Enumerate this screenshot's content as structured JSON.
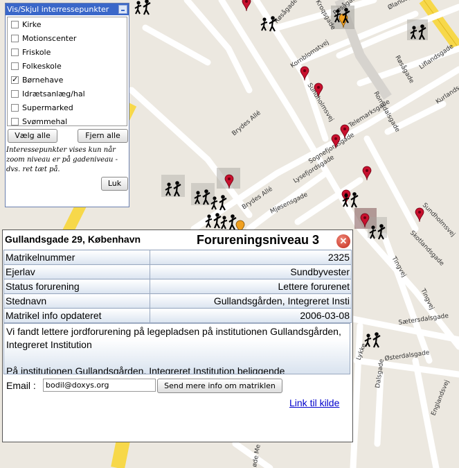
{
  "streets": [
    {
      "name": "Røsågade",
      "cls": "s1"
    },
    {
      "name": "Røsågade",
      "cls": "s2"
    },
    {
      "name": "Røsågade",
      "cls": "s3"
    },
    {
      "name": "Ølandsgade",
      "cls": "s4"
    },
    {
      "name": "Kroqsgade",
      "cls": "s5"
    },
    {
      "name": "Kornblomstvej",
      "cls": "s6"
    },
    {
      "name": "Liflandsgade",
      "cls": "s7"
    },
    {
      "name": "Kurlandsgade",
      "cls": "s8"
    },
    {
      "name": "Sundholmsvej",
      "cls": "s9"
    },
    {
      "name": "Telemarksgade",
      "cls": "s10"
    },
    {
      "name": "Romsdalsgade",
      "cls": "s11"
    },
    {
      "name": "Brydes Allé",
      "cls": "s12"
    },
    {
      "name": "Sognefjordsgade",
      "cls": "s13"
    },
    {
      "name": "Lysefjordsgade",
      "cls": "s14"
    },
    {
      "name": "Brydes Allé",
      "cls": "s15"
    },
    {
      "name": "Mjøsensgade",
      "cls": "s16"
    },
    {
      "name": "Sundholmsvej",
      "cls": "s17"
    },
    {
      "name": "Skotlandsgade",
      "cls": "s18"
    },
    {
      "name": "Tingvej",
      "cls": "s19"
    },
    {
      "name": "Sætersdalsgade",
      "cls": "s20"
    },
    {
      "name": "Østerdalsgade",
      "cls": "s21"
    },
    {
      "name": "Dalsgade",
      "cls": "s22"
    },
    {
      "name": "Englandsvej",
      "cls": "s23"
    },
    {
      "name": "Tingvej",
      "cls": "s24"
    },
    {
      "name": "Lykke",
      "cls": "s25"
    },
    {
      "name": "øde Me",
      "cls": "s26"
    }
  ],
  "poi_panel": {
    "title": "Vis/Skjul interressepunkter",
    "items": [
      {
        "label": "Kirke",
        "checked": false
      },
      {
        "label": "Motionscenter",
        "checked": false
      },
      {
        "label": "Friskole",
        "checked": false
      },
      {
        "label": "Folkeskole",
        "checked": false
      },
      {
        "label": "Børnehave",
        "checked": true
      },
      {
        "label": "Idrætsanlæg/hal",
        "checked": false
      },
      {
        "label": "Supermarked",
        "checked": false
      },
      {
        "label": "Svømmehal",
        "checked": false
      }
    ],
    "select_all": "Vælg alle",
    "remove_all": "Fjern alle",
    "note": "Interessepunkter vises kun når zoom niveau er på gadeniveau - dvs. ret tæt på.",
    "close": "Luk"
  },
  "info": {
    "address": "Gullandsgade 29, København",
    "level": "Forureningsniveau 3",
    "rows": [
      {
        "label": "Matrikelnummer",
        "value": "2325"
      },
      {
        "label": "Ejerlav",
        "value": "Sundbyvester"
      },
      {
        "label": "Status forurening",
        "value": "Lettere forurenet"
      },
      {
        "label": "Stednavn",
        "value": "Gullandsgården, Integreret Insti"
      },
      {
        "label": "Matrikel info opdateret",
        "value": "2006-03-08"
      }
    ],
    "description_1": "Vi fandt lettere jordforurening på legepladsen på institutionen Gullandsgården, Integreret Institution",
    "description_2": "På institutionen Gullandsgården, Integreret Institution beliggende",
    "email_label": "Email :",
    "email_value": "bodil@doxys.org",
    "send_button": "Send mere info om matriklen",
    "source_link": "Link til kilde"
  },
  "colors": {
    "pin_red": "#c8102e",
    "pin_orange": "#f0a020",
    "road_yellow": "#f7d84a"
  }
}
